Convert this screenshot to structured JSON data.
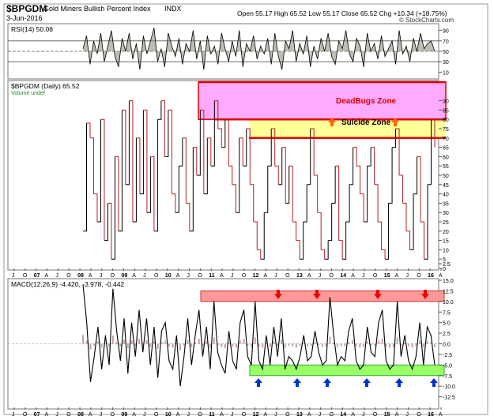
{
  "header": {
    "symbol": "$BPGDM",
    "name": "Gold Miners Bullish Percent Index",
    "exchange": "INDX",
    "date": "3-Jun-2016",
    "quote": "Open 55.17  High 65.52  Low 55.17  Close 65.52  Chg +10.34 (+18.75%)",
    "open_label": "Open",
    "open": "55.17",
    "high_label": "High",
    "high": "65.52",
    "low_label": "Low",
    "low": "55.17",
    "close_label": "Close",
    "close": "65.52",
    "chg_label": "Chg",
    "chg": "+10.34 (+18.75%)",
    "watermark": "© StockCharts.com"
  },
  "colors": {
    "price_up": "#000000",
    "price_down": "#b22222",
    "deadbugs_fill": "#ffaaff",
    "suicide_fill": "#ffff99",
    "zone_border": "#e00000",
    "macd_top_fill": "#ff9999",
    "macd_bottom_fill": "#99ff66",
    "arrow_red": "#ee0000",
    "arrow_blue": "#0033cc",
    "arrow_orange": "#ff6600",
    "rsi_fill": "#888877"
  },
  "chart_data": [
    {
      "panel": "rsi",
      "type": "line",
      "label": "RSI(14) 50.08",
      "last_value": 50.08,
      "ylim": [
        0,
        100
      ],
      "y_ticks": [
        "10",
        "30",
        "50",
        "70",
        "90"
      ],
      "reference_lines": [
        30,
        50,
        70
      ],
      "values": [
        55,
        80,
        25,
        70,
        45,
        85,
        30,
        60,
        90,
        40,
        20,
        75,
        50,
        85,
        35,
        65,
        15,
        80,
        45,
        70,
        95,
        30,
        55,
        20,
        85,
        60,
        40,
        75,
        25,
        65,
        50,
        90,
        35,
        70,
        15,
        80,
        45,
        60,
        25,
        85,
        55,
        30,
        70,
        40,
        90,
        20,
        65,
        50,
        80,
        35,
        60,
        45,
        75,
        25,
        85,
        40,
        15,
        70,
        55,
        90,
        30,
        65,
        45,
        80,
        20,
        60,
        35,
        75,
        50,
        85,
        40,
        25,
        70,
        55,
        90,
        45,
        30,
        75,
        60,
        20,
        85,
        50,
        65,
        35,
        80,
        40,
        55,
        70,
        25,
        90,
        45,
        60,
        30,
        75,
        50,
        85,
        55,
        65,
        70,
        50
      ]
    },
    {
      "panel": "price",
      "type": "line",
      "label": "$BPGDM (Daily) 65.52",
      "sublabel": "Volume undef",
      "last_value": 65.52,
      "ylim": [
        0,
        100
      ],
      "y_ticks": [
        "0",
        "2.5",
        "5",
        "10",
        "15",
        "20",
        "25",
        "30",
        "35",
        "40",
        "45",
        "50",
        "55",
        "60",
        "65",
        "70",
        "75",
        "80",
        "85",
        "90"
      ],
      "x_ticks": [
        "J",
        "O",
        "07",
        "A",
        "J",
        "O",
        "08",
        "A",
        "J",
        "O",
        "09",
        "A",
        "J",
        "O",
        "10",
        "A",
        "J",
        "O",
        "11",
        "A",
        "J",
        "O",
        "12",
        "A",
        "J",
        "O",
        "13",
        "A",
        "J",
        "O",
        "14",
        "A",
        "J",
        "O",
        "15",
        "A",
        "J",
        "O",
        "16",
        "A"
      ],
      "values": [
        20,
        78,
        70,
        40,
        25,
        80,
        15,
        35,
        5,
        60,
        20,
        85,
        45,
        90,
        25,
        70,
        40,
        85,
        30,
        60,
        20,
        80,
        90,
        60,
        85,
        40,
        30,
        55,
        70,
        35,
        20,
        65,
        50,
        85,
        40,
        70,
        55,
        90,
        75,
        65,
        80,
        55,
        45,
        30,
        70,
        55,
        75,
        45,
        25,
        10,
        5,
        30,
        55,
        75,
        55,
        45,
        65,
        35,
        55,
        25,
        15,
        5,
        25,
        45,
        75,
        50,
        30,
        10,
        5,
        15,
        35,
        55,
        15,
        5,
        25,
        45,
        65,
        55,
        40,
        25,
        55,
        65,
        45,
        25,
        10,
        5,
        35,
        65,
        75,
        50,
        35,
        20,
        10,
        40,
        60,
        25,
        5,
        45,
        80,
        65
      ]
    },
    {
      "panel": "macd",
      "type": "line",
      "label": "MACD(12,26,9) -4.420, -3.978, -0.442",
      "macd": -4.42,
      "signal": -3.978,
      "histogram": -0.442,
      "ylim": [
        -15,
        15
      ],
      "y_ticks": [
        "-12.5",
        "-10.0",
        "-7.5",
        "-5.0",
        "-2.5",
        "0.0",
        "2.5",
        "5.0",
        "7.5",
        "10.0",
        "12.5",
        "15.0"
      ],
      "values": [
        14,
        5,
        -9,
        -3,
        4,
        -6,
        2,
        -5,
        13,
        3,
        -4,
        6,
        -7,
        5,
        -3,
        8,
        -2,
        6,
        -5,
        4,
        -8,
        3,
        5,
        -4,
        -6,
        2,
        -10,
        -3,
        6,
        -5,
        2,
        8,
        -3,
        4,
        -6,
        10,
        -2,
        -5,
        -7,
        3,
        -4,
        -6,
        5,
        8,
        -3,
        -5,
        10,
        -4,
        -6,
        2,
        -5,
        4,
        -3,
        6,
        -6,
        -3,
        -4,
        -6,
        -3,
        2,
        -4,
        -3,
        3,
        -2,
        -5,
        -4,
        11,
        2,
        -5,
        -3,
        -4,
        3,
        6,
        -4,
        -6,
        -5,
        4,
        -2,
        -3,
        5,
        8,
        -4,
        -6,
        -5,
        10,
        -3,
        2,
        -4,
        -6,
        -3,
        5,
        -5,
        4,
        2,
        -5
      ]
    }
  ],
  "annotations": {
    "deadbugs_zone": {
      "label": "DeadBugs Zone",
      "y_range": [
        80,
        100
      ]
    },
    "suicide_zone": {
      "label": "Suicide Zone",
      "y_range": [
        70,
        80
      ]
    },
    "macd_top_band": {
      "y_range": [
        10,
        12.5
      ]
    },
    "macd_bottom_band": {
      "y_range": [
        -7.5,
        -5
      ]
    }
  }
}
